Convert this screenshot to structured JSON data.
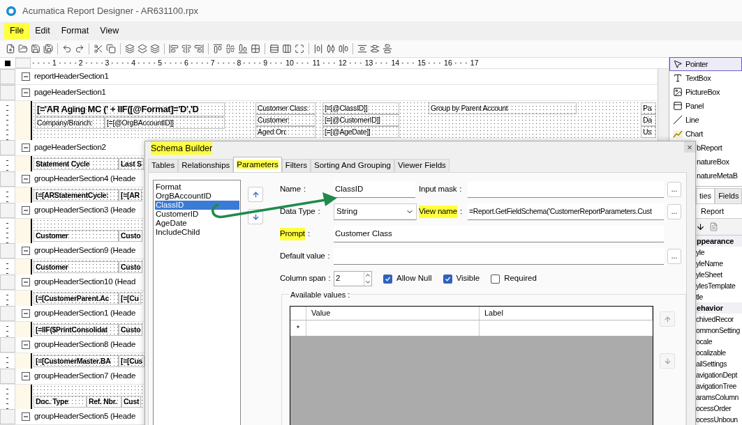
{
  "window": {
    "title": "Acumatica Report Designer - AR631100.rpx"
  },
  "menu": [
    {
      "label": "File",
      "highlighted": true
    },
    {
      "label": "Edit",
      "highlighted": false
    },
    {
      "label": "Format",
      "highlighted": false
    },
    {
      "label": "View",
      "highlighted": false
    }
  ],
  "ruler": [
    "1",
    "2",
    "3",
    "4",
    "5",
    "6",
    "7",
    "8",
    "9",
    "10",
    "11",
    "12",
    "13",
    "14",
    "15",
    "16",
    "17"
  ],
  "sections": [
    {
      "title": "reportHeaderSection1"
    },
    {
      "title": "pageHeaderSection1",
      "body": {
        "kind": "title_block",
        "title": "[='AR Aging MC (' + IIF([@Format]='D','D",
        "company_label": "Company/Branch:",
        "company_value": "[=[@OrgBAccountID]]",
        "criteria": [
          {
            "label": "Customer Class:",
            "value": "[=[@ClassID]]"
          },
          {
            "label": "Customer:",
            "value": "[=[@CustomerID]]"
          },
          {
            "label": "Aged On:",
            "value": "[=[@AgeDate]]"
          }
        ],
        "group_label": "Group by Parent Account",
        "edge": [
          "Pa",
          "Da",
          "Us"
        ]
      }
    },
    {
      "title": "pageHeaderSection2",
      "body": {
        "kind": "cells",
        "cells": [
          "Statement Cycle",
          "Last S"
        ]
      }
    },
    {
      "title": "groupHeaderSection4 (Heade",
      "body": {
        "kind": "cells",
        "cells": [
          "[=[ARStatementCycle:",
          "[=[AR"
        ]
      }
    },
    {
      "title": "groupHeaderSection3 (Heade",
      "body": {
        "kind": "cells",
        "blank_row": true,
        "cells": [
          "Customer",
          "Custo"
        ]
      }
    },
    {
      "title": "groupHeaderSection9 (Heade",
      "body": {
        "kind": "cells",
        "cells": [
          "Customer",
          "Custo"
        ]
      }
    },
    {
      "title": "groupHeaderSection10 (Head",
      "body": {
        "kind": "cells",
        "cells": [
          "[=[CustomerParent.Ac",
          "[=[Cu"
        ]
      }
    },
    {
      "title": "groupHeaderSection1 (Heade",
      "body": {
        "kind": "cells",
        "cells": [
          "[=IIF($PrintConsolidat",
          "Custo"
        ]
      }
    },
    {
      "title": "groupHeaderSection8 (Heade",
      "body": {
        "kind": "cells",
        "cells": [
          "[=[CustomerMaster.BA",
          "[=[Cus"
        ]
      }
    },
    {
      "title": "groupHeaderSection7 (Heade",
      "body": {
        "kind": "cells",
        "blank_row": true,
        "cells": [
          "Doc. Type",
          "Ref. Nbr.",
          "Cust"
        ]
      }
    },
    {
      "title": "groupHeaderSection5 (Heade"
    }
  ],
  "toolbox": [
    {
      "label": "Pointer",
      "selected": true
    },
    {
      "label": "TextBox",
      "selected": false
    },
    {
      "label": "PictureBox",
      "selected": false
    },
    {
      "label": "Panel",
      "selected": false
    },
    {
      "label": "Line",
      "selected": false
    },
    {
      "label": "Chart",
      "selected": false
    },
    {
      "label": "bReport",
      "selected": false
    },
    {
      "label": "natureBox",
      "selected": false
    },
    {
      "label": "natureMetaB",
      "selected": false
    }
  ],
  "properties": {
    "tabs": [
      {
        "label": "ties",
        "selected": true
      },
      {
        "label": "Fields",
        "selected": false
      }
    ],
    "object": "Report",
    "items": [
      {
        "kind": "category",
        "label": "ppearance"
      },
      {
        "kind": "property",
        "label": "yle"
      },
      {
        "kind": "property",
        "label": "yleName"
      },
      {
        "kind": "property",
        "label": "yleSheet"
      },
      {
        "kind": "property",
        "label": "ylesTemplate"
      },
      {
        "kind": "property",
        "label": "tle"
      },
      {
        "kind": "category",
        "label": "ehavior"
      },
      {
        "kind": "property",
        "label": "chivedRecor"
      },
      {
        "kind": "property",
        "label": "ommonSetting"
      },
      {
        "kind": "property",
        "label": "ocale"
      },
      {
        "kind": "property",
        "label": "ocalizable"
      },
      {
        "kind": "property",
        "label": "ailSettings"
      },
      {
        "kind": "property",
        "label": "avigationDept"
      },
      {
        "kind": "property",
        "label": "avigationTree"
      },
      {
        "kind": "property",
        "label": "aramsColumn"
      },
      {
        "kind": "property",
        "label": "ocessOrder"
      },
      {
        "kind": "property",
        "label": "ocessUnboun"
      }
    ]
  },
  "dialog": {
    "title": "Schema Builder",
    "title_highlighted": true,
    "close": "×",
    "tabs": [
      {
        "label": "Tables",
        "selected": false,
        "highlighted": false
      },
      {
        "label": "Relationships",
        "selected": false,
        "highlighted": false
      },
      {
        "label": "Parameters",
        "selected": true,
        "highlighted": true
      },
      {
        "label": "Filters",
        "selected": false,
        "highlighted": false
      },
      {
        "label": "Sorting And Grouping",
        "selected": false,
        "highlighted": false
      },
      {
        "label": "Viewer Fields",
        "selected": false,
        "highlighted": false
      }
    ],
    "parameters": [
      {
        "label": "Format",
        "selected": false
      },
      {
        "label": "OrgBAccountID",
        "selected": false
      },
      {
        "label": "ClassID",
        "selected": true
      },
      {
        "label": "CustomerID",
        "selected": false
      },
      {
        "label": "AgeDate",
        "selected": false
      },
      {
        "label": "IncludeChild",
        "selected": false
      }
    ],
    "labels": {
      "name": {
        "text": "Name",
        "colon": ":",
        "highlighted": false
      },
      "input_mask": {
        "text": "Input mask",
        "colon": ":",
        "highlighted": false
      },
      "data_type": {
        "text": "Data Type",
        "colon": ":",
        "highlighted": false
      },
      "view_name": {
        "text": "View name",
        "colon": ":",
        "highlighted": true
      },
      "prompt": {
        "text": "Prompt",
        "colon": ":",
        "highlighted": true
      },
      "default_value": {
        "text": "Default value",
        "colon": ":",
        "highlighted": false
      },
      "column_span": {
        "text": "Column span",
        "colon": ":",
        "highlighted": false
      }
    },
    "name_value": "ClassID",
    "data_type_value": "String",
    "view_name_value": "=Report.GetFieldSchema('CustomerReportParameters.Cust",
    "prompt_value": "Customer Class",
    "column_span_value": "2",
    "browse_buttons": [
      "...",
      "...",
      "..."
    ],
    "checkboxes": [
      {
        "label": "Allow Null",
        "checked": true
      },
      {
        "label": "Visible",
        "checked": true
      },
      {
        "label": "Required",
        "checked": false
      }
    ],
    "available_values": {
      "title": "Available values :",
      "columns": [
        "Value",
        "Label"
      ],
      "new_row_marker": "*"
    }
  }
}
